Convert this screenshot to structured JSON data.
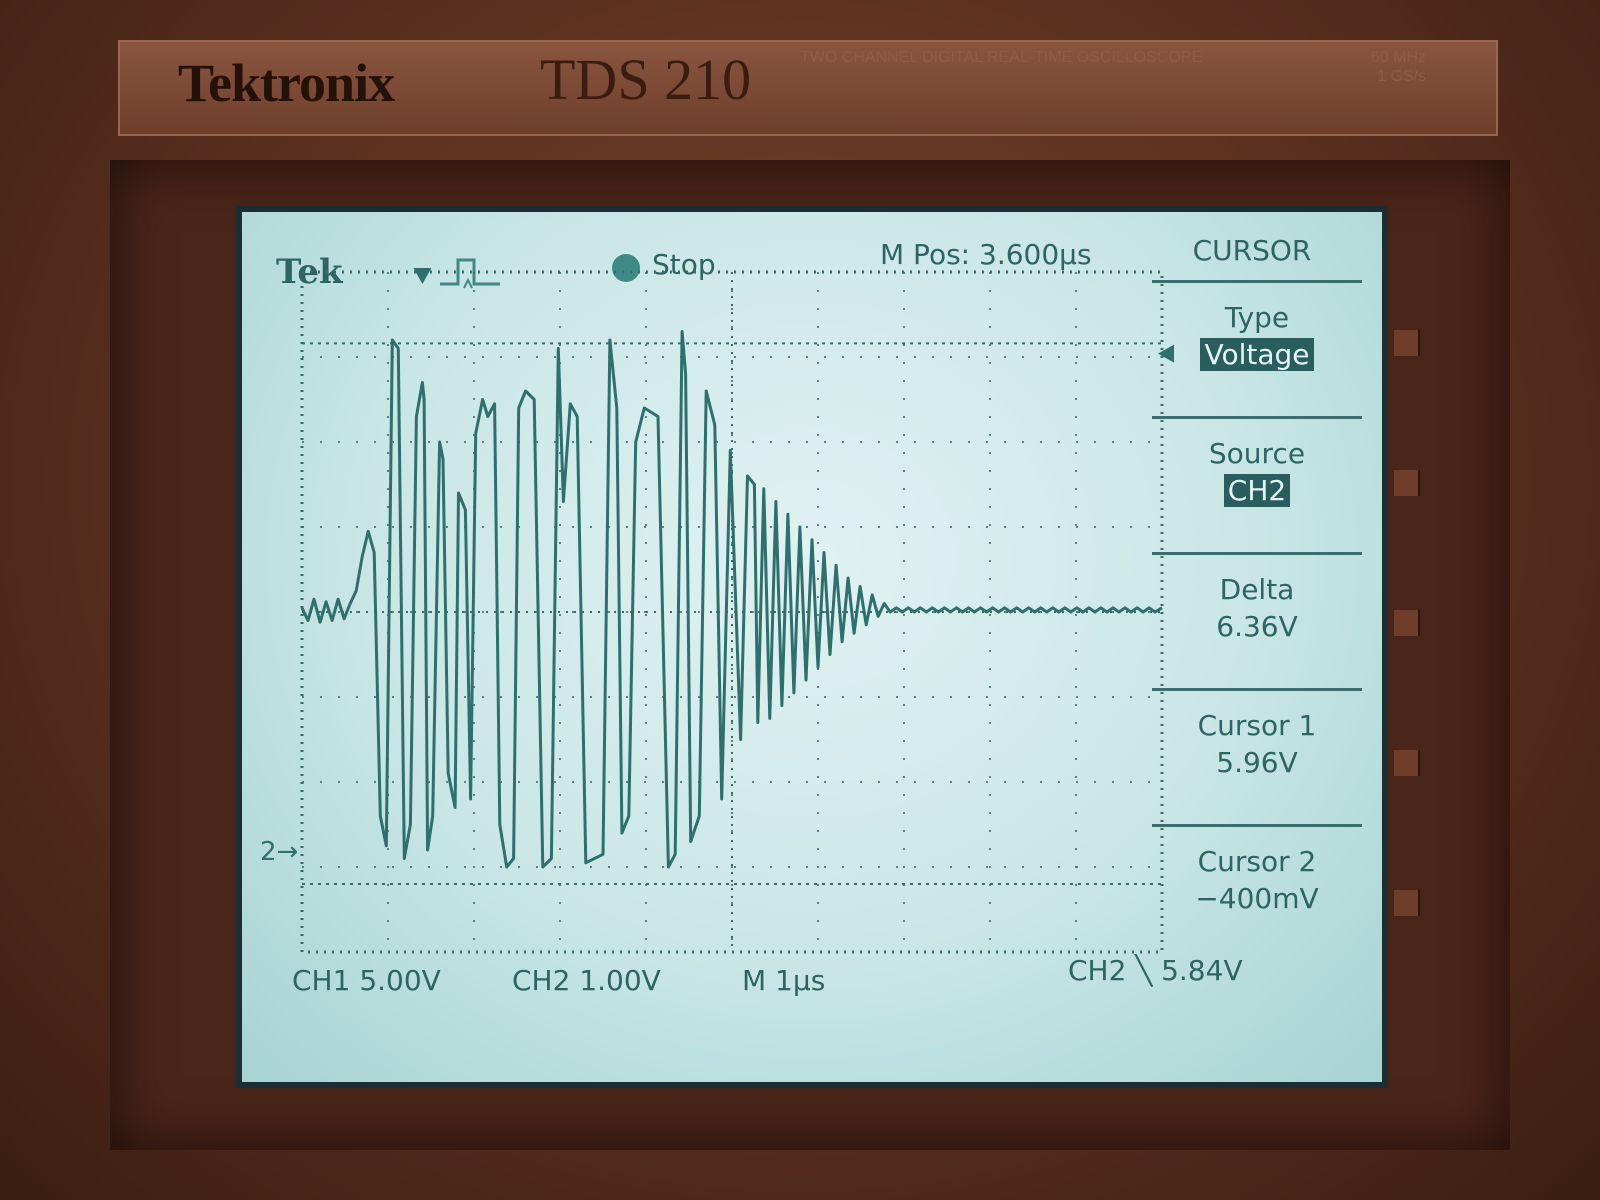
{
  "instrument": {
    "brand": "Tektronix",
    "model": "TDS 210",
    "description": "TWO CHANNEL DIGITAL REAL-TIME OSCILLOSCOPE",
    "spec_bandwidth": "60 MHz",
    "spec_sample_rate": "1 GS/s"
  },
  "screen": {
    "tek_label": "Tek",
    "run_state": "Stop",
    "m_pos": "M Pos: 3.600µs"
  },
  "menu": {
    "title": "CURSOR",
    "items": [
      {
        "label": "Type",
        "value": "Voltage",
        "highlighted": true
      },
      {
        "label": "Source",
        "value": "CH2",
        "highlighted": true
      },
      {
        "label": "Delta",
        "value": "6.36V",
        "highlighted": false
      },
      {
        "label": "Cursor 1",
        "value": "5.96V",
        "highlighted": false
      },
      {
        "label": "Cursor 2",
        "value": "−400mV",
        "highlighted": false
      }
    ]
  },
  "status": {
    "ch1": "CH1 5.00V",
    "ch2": "CH2 1.00V",
    "timebase": "M 1µs",
    "trigger_source": "CH2",
    "trigger_symbol": "╲",
    "trigger_level": "5.84V",
    "ch2_marker": "2→"
  },
  "colors": {
    "screen_bg": "#c9e6e5",
    "trace": "#2f6f6d",
    "grid": "#3a6a6a",
    "highlight_bg": "#2a5e5e"
  },
  "chart_data": {
    "type": "line",
    "title": "",
    "xlabel": "",
    "ylabel": "",
    "x_units": "µs",
    "y_units": "V",
    "xlim": [
      -1.4,
      8.6
    ],
    "ylim": [
      -1.2,
      6.8
    ],
    "grid": true,
    "cursors": [
      5.96,
      -0.4
    ],
    "series": [
      {
        "x": [
          -1.4,
          -1.33,
          -1.26,
          -1.19,
          -1.12,
          -1.05,
          -0.98,
          -0.91,
          -0.84,
          -0.77,
          -0.7,
          -0.63,
          -0.56,
          -0.49,
          -0.42,
          -0.35,
          -0.28,
          -0.21,
          -0.14,
          -0.07,
          0.0,
          0.02,
          0.06,
          0.12,
          0.2,
          0.24,
          0.3,
          0.38,
          0.42,
          0.5,
          0.56,
          0.62,
          0.7,
          0.76,
          0.84,
          0.9,
          0.98,
          1.06,
          1.12,
          1.2,
          1.3,
          1.4,
          1.5,
          1.58,
          1.64,
          1.72,
          1.8,
          1.9,
          2.1,
          2.18,
          2.26,
          2.32,
          2.4,
          2.48,
          2.58,
          2.74,
          2.86,
          2.94,
          3.02,
          3.06,
          3.12,
          3.22,
          3.3,
          3.4,
          3.48,
          3.58,
          3.7,
          3.78,
          3.86,
          3.9,
          3.97,
          4.04,
          4.11,
          4.18,
          4.25,
          4.32,
          4.39,
          4.46,
          4.53,
          4.6,
          4.67,
          4.74,
          4.81,
          4.88,
          4.95,
          5.02,
          5.09,
          5.16,
          5.23,
          5.3,
          5.37,
          5.44,
          5.51,
          5.58,
          5.65,
          5.72,
          5.79,
          5.86,
          5.93,
          6.0,
          6.07,
          6.14,
          6.21,
          6.28,
          6.35,
          6.42,
          6.49,
          6.56,
          6.63,
          6.7,
          6.77,
          6.84,
          6.91,
          6.98,
          7.05,
          7.12,
          7.19,
          7.26,
          7.33,
          7.4,
          7.47,
          7.54,
          7.61,
          7.68,
          7.75,
          7.82,
          7.89,
          7.96,
          8.03,
          8.1,
          8.17,
          8.24,
          8.31,
          8.38,
          8.45,
          8.52,
          8.6
        ],
        "values": [
          2.85,
          2.7,
          2.95,
          2.68,
          2.92,
          2.7,
          2.95,
          2.72,
          2.9,
          3.05,
          3.45,
          3.75,
          3.5,
          0.4,
          0.05,
          6.0,
          5.9,
          -0.1,
          0.3,
          5.1,
          5.5,
          5.3,
          0.0,
          0.4,
          4.8,
          4.6,
          0.9,
          0.5,
          4.2,
          4.0,
          0.6,
          4.9,
          5.3,
          5.1,
          5.25,
          0.3,
          -0.2,
          -0.1,
          5.2,
          5.4,
          5.3,
          -0.2,
          -0.1,
          5.9,
          4.1,
          5.25,
          5.1,
          -0.15,
          -0.05,
          6.0,
          5.2,
          0.2,
          0.4,
          4.8,
          5.2,
          5.1,
          -0.2,
          -0.05,
          6.1,
          5.6,
          0.1,
          0.4,
          5.4,
          5.0,
          0.6,
          4.7,
          1.3,
          4.4,
          4.3,
          1.5,
          4.25,
          1.55,
          4.1,
          1.7,
          3.95,
          1.85,
          3.8,
          2.0,
          3.65,
          2.15,
          3.5,
          2.3,
          3.35,
          2.45,
          3.2,
          2.55,
          3.1,
          2.65,
          3.0,
          2.75,
          2.9,
          2.8,
          2.85,
          2.8,
          2.85,
          2.8,
          2.85,
          2.8,
          2.85,
          2.8,
          2.85,
          2.8,
          2.85,
          2.8,
          2.85,
          2.8,
          2.85,
          2.8,
          2.85,
          2.8,
          2.85,
          2.8,
          2.85,
          2.8,
          2.85,
          2.8,
          2.85,
          2.8,
          2.85,
          2.8,
          2.85,
          2.8,
          2.85,
          2.8,
          2.85,
          2.8,
          2.85,
          2.8,
          2.85,
          2.8,
          2.85,
          2.8,
          2.85,
          2.8,
          2.85,
          2.8,
          2.85
        ]
      }
    ]
  }
}
